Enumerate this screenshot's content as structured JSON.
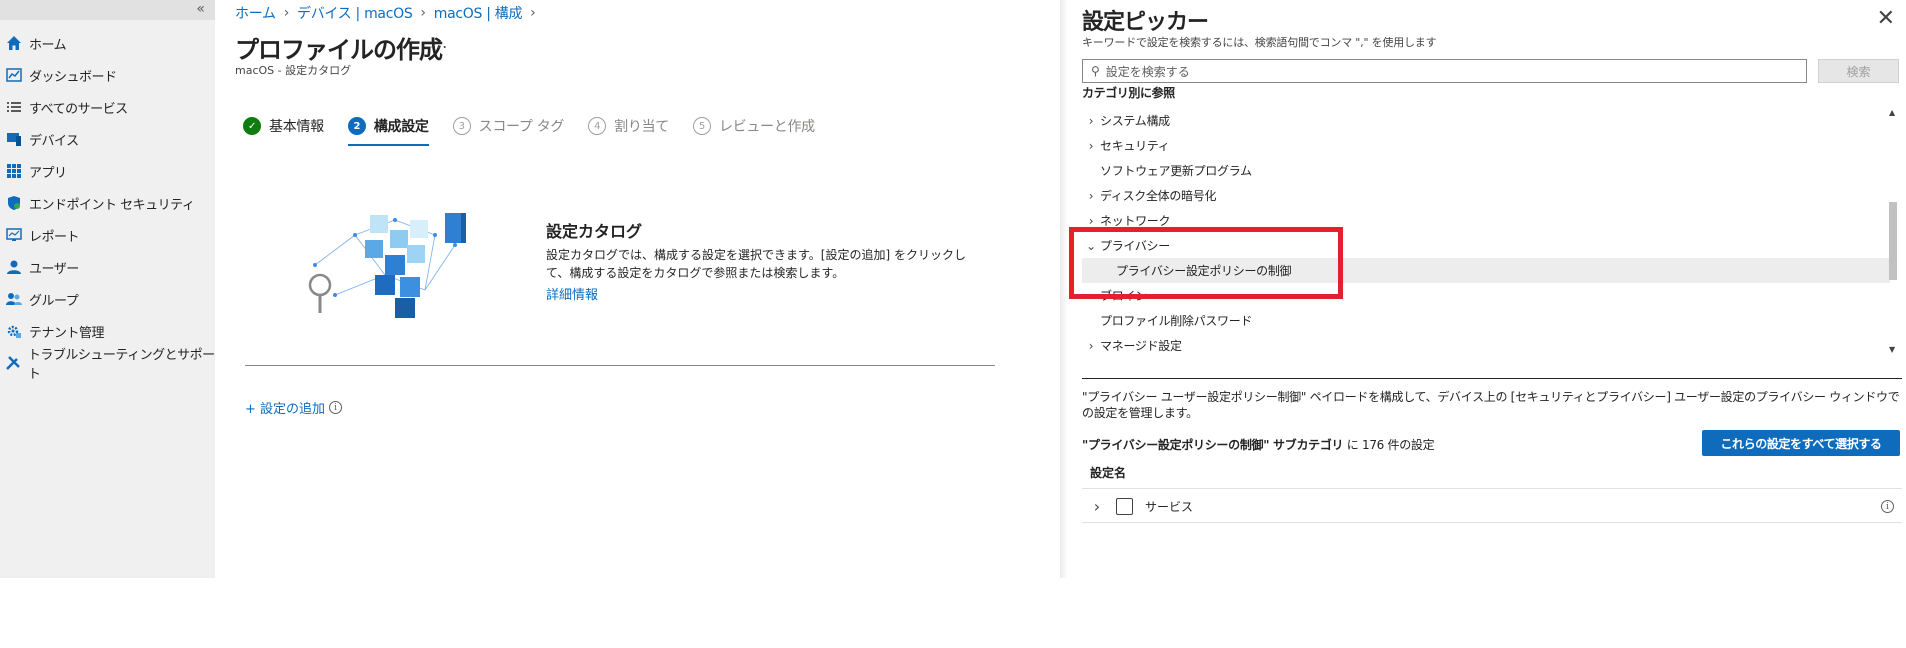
{
  "sidebar": {
    "collapse_glyph": "«",
    "items": [
      {
        "label": "ホーム",
        "icon": "home-icon",
        "color": "#0f6cbd"
      },
      {
        "label": "ダッシュボード",
        "icon": "dashboard-icon",
        "color": "#0f6cbd"
      },
      {
        "label": "すべてのサービス",
        "icon": "list-icon",
        "color": "#5a5a5a"
      },
      {
        "label": "デバイス",
        "icon": "device-icon",
        "color": "#0f6cbd"
      },
      {
        "label": "アプリ",
        "icon": "apps-icon",
        "color": "#0f6cbd"
      },
      {
        "label": "エンドポイント セキュリティ",
        "icon": "shield-icon",
        "color": "#0f6cbd"
      },
      {
        "label": "レポート",
        "icon": "report-icon",
        "color": "#0f6cbd"
      },
      {
        "label": "ユーザー",
        "icon": "user-icon",
        "color": "#0f6cbd"
      },
      {
        "label": "グループ",
        "icon": "group-icon",
        "color": "#0f6cbd"
      },
      {
        "label": "テナント管理",
        "icon": "tenant-icon",
        "color": "#0f6cbd"
      },
      {
        "label": "トラブルシューティングとサポート",
        "icon": "tools-icon",
        "color": "#0f6cbd"
      }
    ]
  },
  "main": {
    "breadcrumb": [
      "ホーム",
      "デバイス | macOS",
      "macOS | 構成"
    ],
    "title": "プロファイルの作成",
    "more": "...",
    "subtitle": "macOS - 設定カタログ",
    "steps": [
      {
        "num": "✓",
        "label": "基本情報",
        "state": "done"
      },
      {
        "num": "2",
        "label": "構成設定",
        "state": "active"
      },
      {
        "num": "3",
        "label": "スコープ タグ",
        "state": "pending"
      },
      {
        "num": "4",
        "label": "割り当て",
        "state": "pending"
      },
      {
        "num": "5",
        "label": "レビューと作成",
        "state": "pending"
      }
    ],
    "catalog_title": "設定カタログ",
    "catalog_desc": "設定カタログでは、構成する設定を選択できます。[設定の追加] をクリックして、構成する設定をカタログで参照または検索します。",
    "catalog_link": "詳細情報",
    "add_setting": "+ 設定の追加",
    "info_glyph": "i"
  },
  "picker": {
    "title": "設定ピッカー",
    "close": "✕",
    "hint": "キーワードで設定を検索するには、検索語句間でコンマ \",\" を使用します",
    "search_placeholder": "設定を検索する",
    "search_button": "検索",
    "browse_label": "カテゴリ別に参照",
    "tree": [
      {
        "label": "システム構成",
        "chevron": "›",
        "type": "collapsed"
      },
      {
        "label": "セキュリティ",
        "chevron": "›",
        "type": "collapsed"
      },
      {
        "label": "ソフトウェア更新プログラム",
        "chevron": "",
        "type": "leaf"
      },
      {
        "label": "ディスク全体の暗号化",
        "chevron": "›",
        "type": "collapsed"
      },
      {
        "label": "ネットワーク",
        "chevron": "›",
        "type": "collapsed"
      },
      {
        "label": "プライバシー",
        "chevron": "⌄",
        "type": "expanded"
      },
      {
        "label": "プライバシー設定ポリシーの制御",
        "chevron": "",
        "type": "child"
      },
      {
        "label": "ブロイン",
        "chevron": "›",
        "type": "collapsed"
      },
      {
        "label": "プロファイル削除パスワード",
        "chevron": "",
        "type": "leaf"
      },
      {
        "label": "マネージド設定",
        "chevron": "›",
        "type": "collapsed"
      }
    ],
    "description": "\"プライバシー ユーザー設定ポリシー制御\" ペイロードを構成して、デバイス上の [セキュリティとプライバシー] ユーザー設定のプライバシー ウィンドウでの設定を管理します。",
    "count_name": "\"プライバシー設定ポリシーの制御\" サブカテゴリ",
    "count_suffix": "に 176 件の設定",
    "select_all": "これらの設定をすべて選択する",
    "column_header": "設定名",
    "rows": [
      {
        "label": "サービス"
      }
    ],
    "highlight_color": "#e3202b"
  }
}
